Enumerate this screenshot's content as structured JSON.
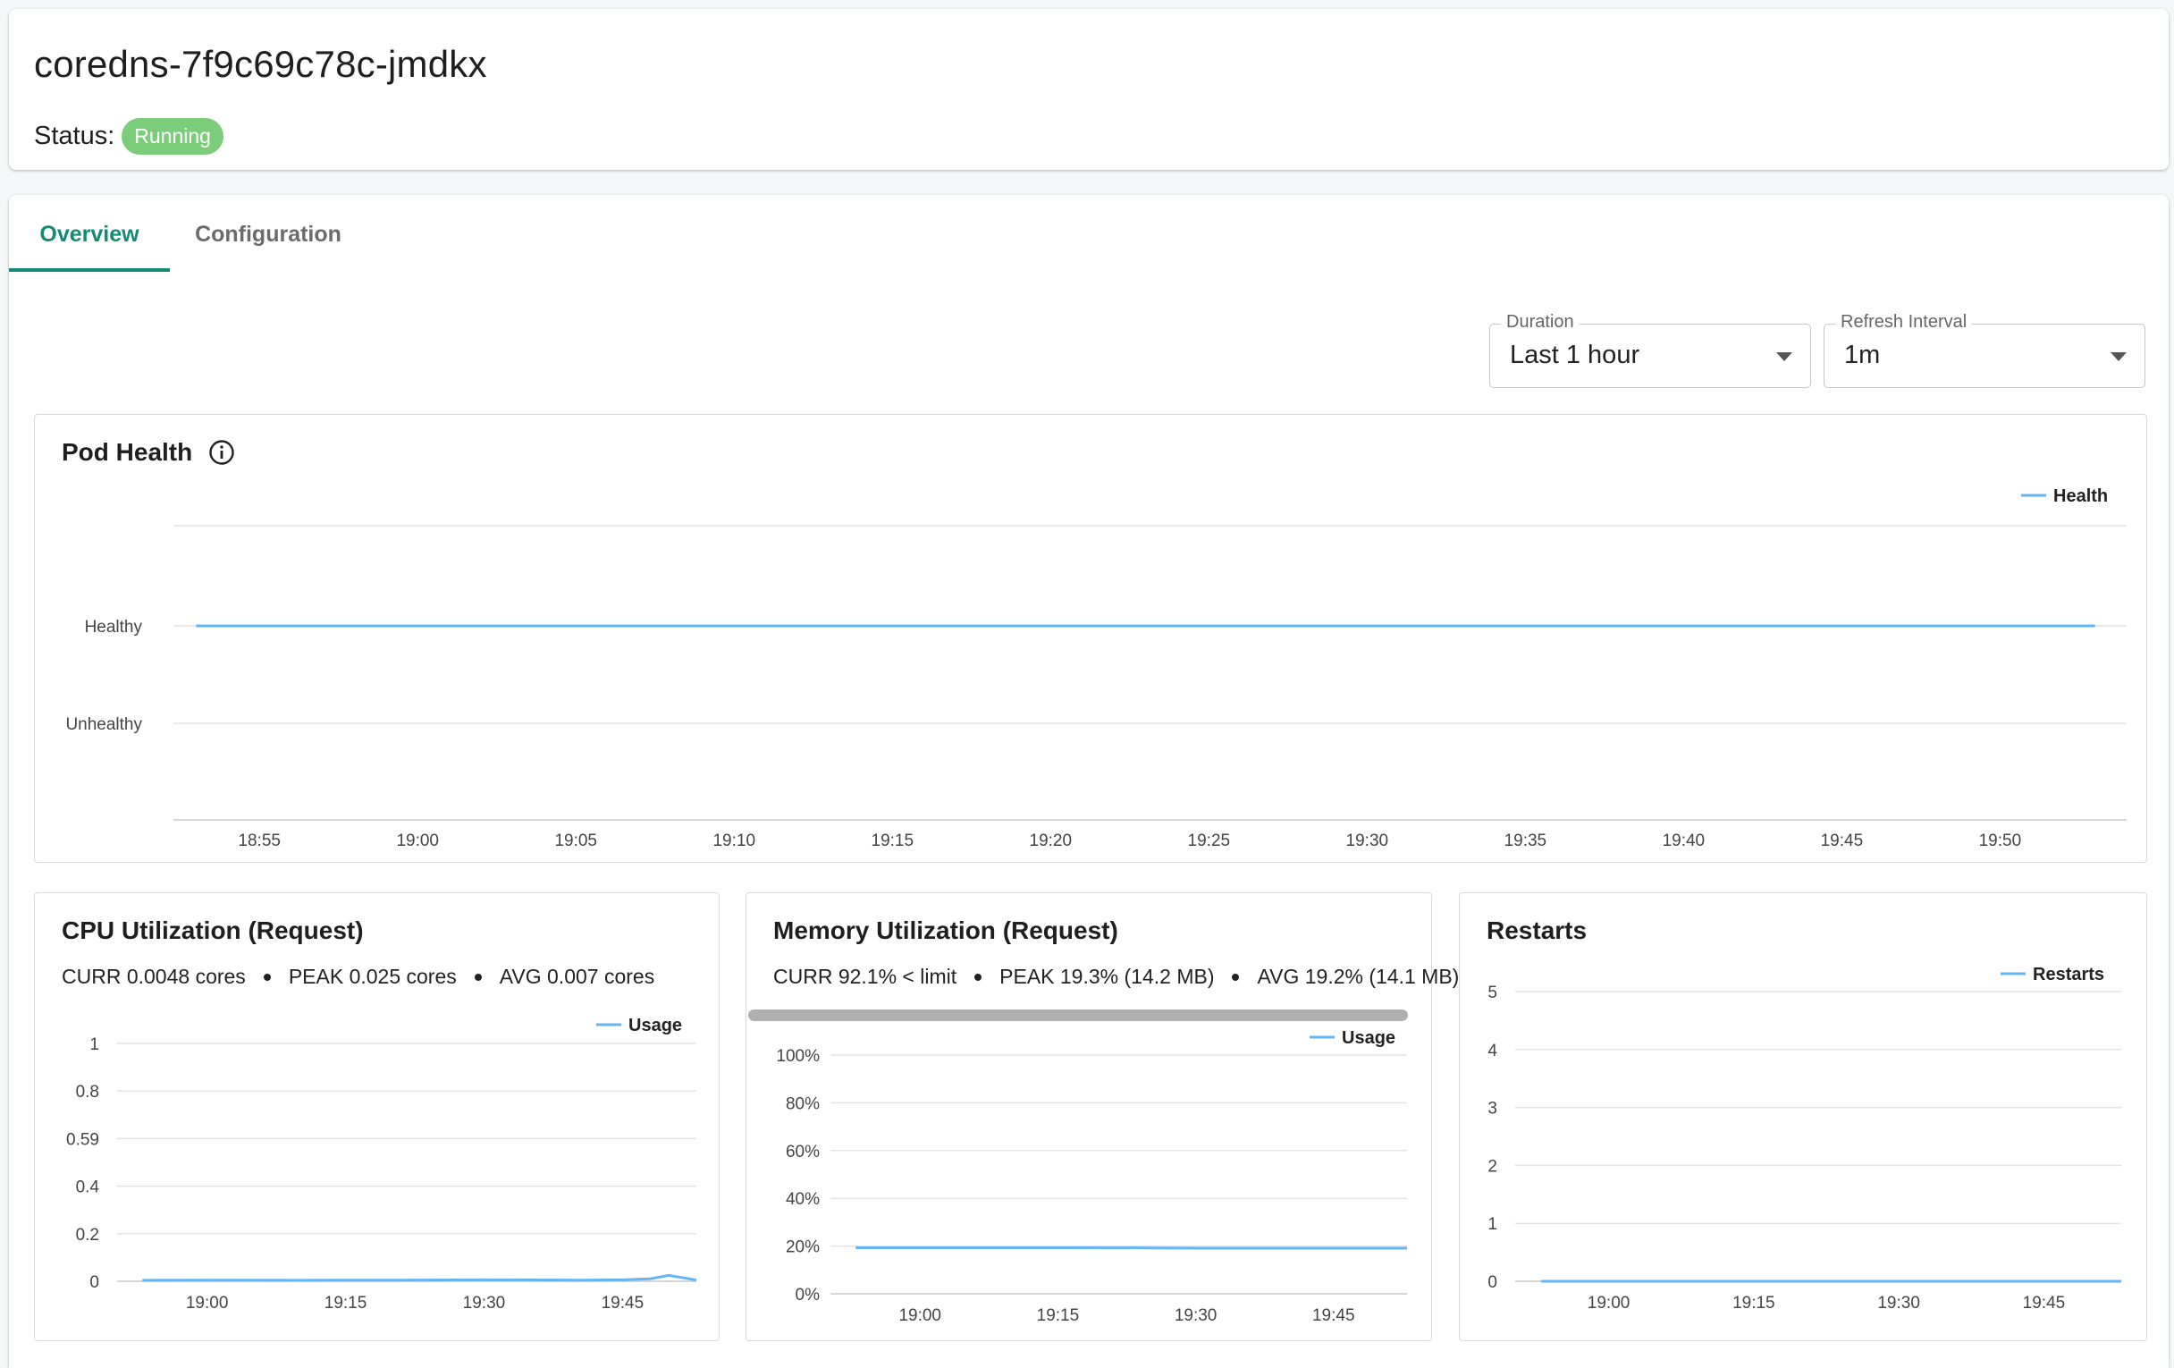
{
  "header": {
    "pod_name": "coredns-7f9c69c78c-jmdkx",
    "status_label": "Status:",
    "status_value": "Running",
    "status_color": "#7ccd7a"
  },
  "tabs": [
    {
      "label": "Overview",
      "active": true
    },
    {
      "label": "Configuration",
      "active": false
    }
  ],
  "controls": {
    "duration": {
      "label": "Duration",
      "value": "Last 1 hour"
    },
    "refresh": {
      "label": "Refresh Interval",
      "value": "1m"
    }
  },
  "accent_color": "#138a72",
  "series_color": "#64b5f6",
  "pod_health": {
    "title": "Pod Health",
    "info_icon": "info-icon",
    "chart_data": {
      "type": "line",
      "y_categories": [
        "Unhealthy",
        "Healthy"
      ],
      "x_ticks": [
        "18:55",
        "19:00",
        "19:05",
        "19:10",
        "19:15",
        "19:20",
        "19:25",
        "19:30",
        "19:35",
        "19:40",
        "19:45",
        "19:50"
      ],
      "series": [
        {
          "name": "Health",
          "x": [
            "18:53",
            "19:53"
          ],
          "values": [
            "Healthy",
            "Healthy"
          ]
        }
      ],
      "legend": "top-right",
      "grid": true
    }
  },
  "cpu": {
    "title": "CPU Utilization (Request)",
    "stats": [
      "CURR 0.0048 cores",
      "PEAK 0.025 cores",
      "AVG 0.007 cores"
    ],
    "chart_data": {
      "type": "line",
      "y_ticks": [
        "1",
        "0.8",
        "0.59",
        "0.4",
        "0.2",
        "0"
      ],
      "ylim": [
        0,
        1
      ],
      "x_ticks": [
        "19:00",
        "19:15",
        "19:30",
        "19:45"
      ],
      "series": [
        {
          "name": "Usage",
          "x": [
            "18:53",
            "19:00",
            "19:10",
            "19:20",
            "19:30",
            "19:40",
            "19:45",
            "19:48",
            "19:50",
            "19:52",
            "19:53"
          ],
          "values": [
            0.004,
            0.005,
            0.004,
            0.005,
            0.006,
            0.005,
            0.006,
            0.01,
            0.025,
            0.012,
            0.005
          ]
        }
      ],
      "legend": "top-right",
      "grid": true
    }
  },
  "memory": {
    "title": "Memory Utilization (Request)",
    "stats": [
      "CURR 92.1% < limit",
      "PEAK 19.3% (14.2 MB)",
      "AVG 19.2% (14.1 MB)"
    ],
    "chart_data": {
      "type": "line",
      "y_ticks": [
        "100%",
        "80%",
        "60%",
        "40%",
        "20%",
        "0%"
      ],
      "ylim": [
        0,
        100
      ],
      "x_ticks": [
        "19:00",
        "19:15",
        "19:30",
        "19:45"
      ],
      "series": [
        {
          "name": "Usage",
          "x": [
            "18:53",
            "19:00",
            "19:15",
            "19:25",
            "19:30",
            "19:45",
            "19:53"
          ],
          "values": [
            19.3,
            19.3,
            19.3,
            19.2,
            19.1,
            19.1,
            19.1
          ]
        }
      ],
      "legend": "top-right",
      "grid": true
    }
  },
  "restarts": {
    "title": "Restarts",
    "chart_data": {
      "type": "line",
      "y_ticks": [
        "5",
        "4",
        "3",
        "2",
        "1",
        "0"
      ],
      "ylim": [
        0,
        5
      ],
      "x_ticks": [
        "19:00",
        "19:15",
        "19:30",
        "19:45"
      ],
      "series": [
        {
          "name": "Restarts",
          "x": [
            "18:53",
            "19:53"
          ],
          "values": [
            0,
            0
          ]
        }
      ],
      "legend": "top-right",
      "grid": true
    }
  }
}
